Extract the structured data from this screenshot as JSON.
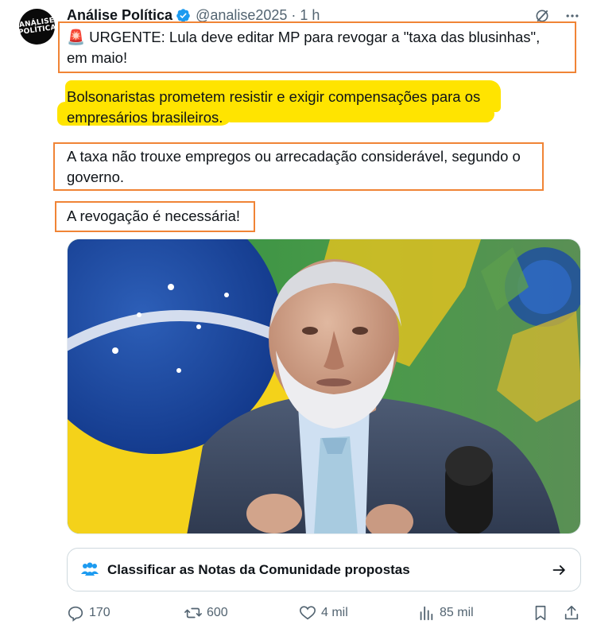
{
  "author": {
    "name": "Análise Política",
    "handle": "@analise2025",
    "separator": "·",
    "time": "1 h",
    "avatar_line1": "ANÁLISE",
    "avatar_line2": "POLÍTICA"
  },
  "post": {
    "paragraphs": [
      "🚨 URGENTE: Lula deve editar MP para revogar a \"taxa das blusinhas\", em maio!",
      "Bolsonaristas prometem resistir e exigir compensações para os empresários brasileiros.",
      "A taxa não trouxe empregos ou arrecadação considerável, segundo o governo.",
      "A revogação é necessária!"
    ]
  },
  "community_notes": {
    "label": "Classificar as Notas da Comunidade propostas"
  },
  "actions": {
    "replies": "170",
    "reposts": "600",
    "likes": "4 mil",
    "views": "85 mil"
  },
  "colors": {
    "annotation_box": "#f08436",
    "highlight": "#ffe400",
    "verified": "#1d9bf0",
    "secondary_text": "#536471"
  },
  "icons": [
    "grok-icon",
    "more-icon",
    "verified-badge-icon",
    "community-notes-icon",
    "arrow-right-icon",
    "reply-icon",
    "repost-icon",
    "like-icon",
    "views-icon",
    "bookmark-icon",
    "share-icon"
  ]
}
